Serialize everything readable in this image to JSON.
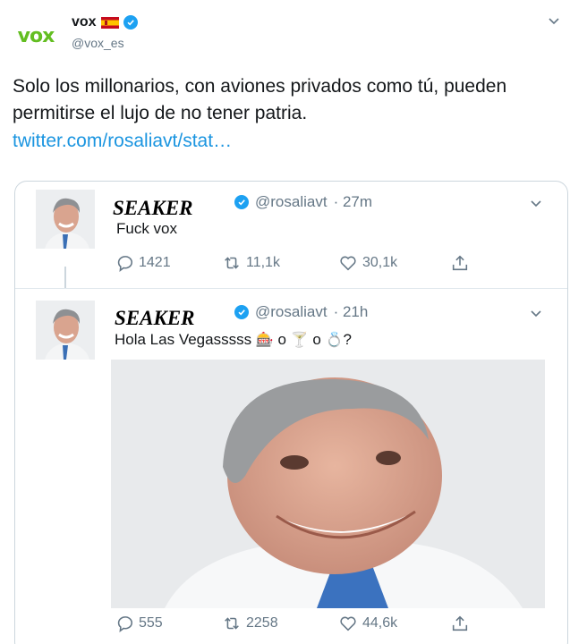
{
  "tweet": {
    "logo_text": "vox",
    "display_name": "vox",
    "handle": "@vox_es",
    "text": "Solo los millonarios, con aviones privados como tú, pueden permitirse el lujo de no tener patria.",
    "link": "twitter.com/rosaliavt/stat…"
  },
  "thread": [
    {
      "name": "SEAKER",
      "handle": "@rosaliavt",
      "time": "· 27m",
      "text": "Fuck vox",
      "replies": "1421",
      "retweets": "11,1k",
      "likes": "30,1k"
    },
    {
      "name": "SEAKER",
      "handle": "@rosaliavt",
      "time": "· 21h",
      "text_prefix": "Hola Las Vegasssss",
      "emoji_1": "🎰",
      "word_o1": "o",
      "emoji_2": "🍸",
      "word_o2": "o",
      "emoji_3": "💍",
      "text_suffix": "?",
      "replies": "555",
      "retweets": "2258",
      "likes": "44,6k"
    }
  ],
  "colors": {
    "brand_green": "#63be21",
    "verified_blue": "#1da1f2",
    "link_blue": "#1b95e0",
    "muted": "#657786"
  }
}
